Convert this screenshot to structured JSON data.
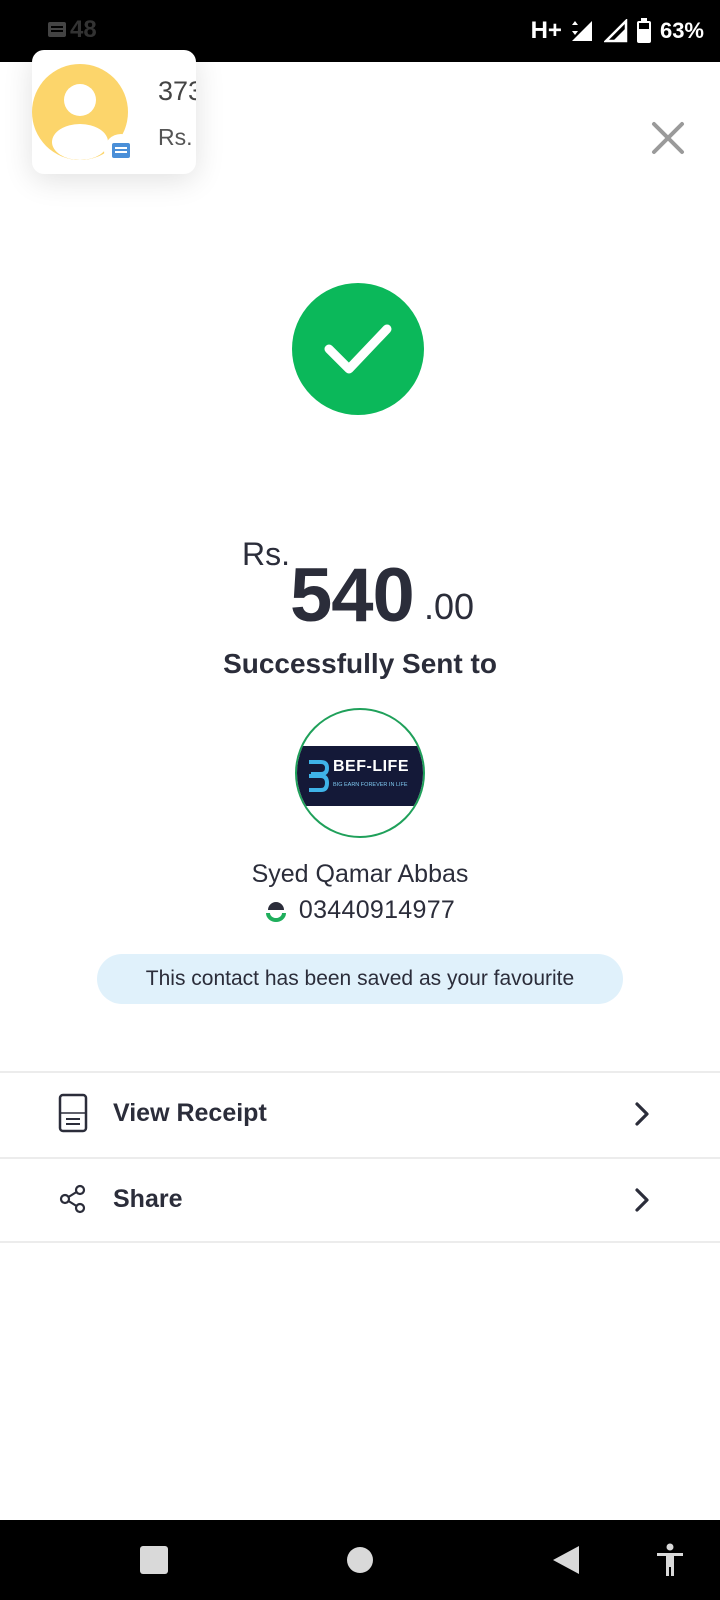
{
  "status_bar": {
    "time": "48",
    "network": "H+",
    "battery_percent": "63%"
  },
  "notification": {
    "line1": "373",
    "line2": "Rs."
  },
  "transaction": {
    "currency": "Rs.",
    "amount_main": "540",
    "amount_decimal": ".00",
    "status_text": "Successfully Sent to"
  },
  "recipient": {
    "logo_title": "BEF-LIFE",
    "logo_subtitle": "BIG EARN FOREVER IN LIFE",
    "name": "Syed Qamar Abbas",
    "phone": "03440914977"
  },
  "favourite_banner": "This contact has been saved as your favourite",
  "actions": [
    {
      "label": "View Receipt",
      "icon": "receipt-icon"
    },
    {
      "label": "Share",
      "icon": "share-icon"
    }
  ],
  "colors": {
    "success": "#0bb85a",
    "banner_bg": "#e0f1fb",
    "text": "#2b2d3a",
    "avatar": "#fcd56b"
  }
}
